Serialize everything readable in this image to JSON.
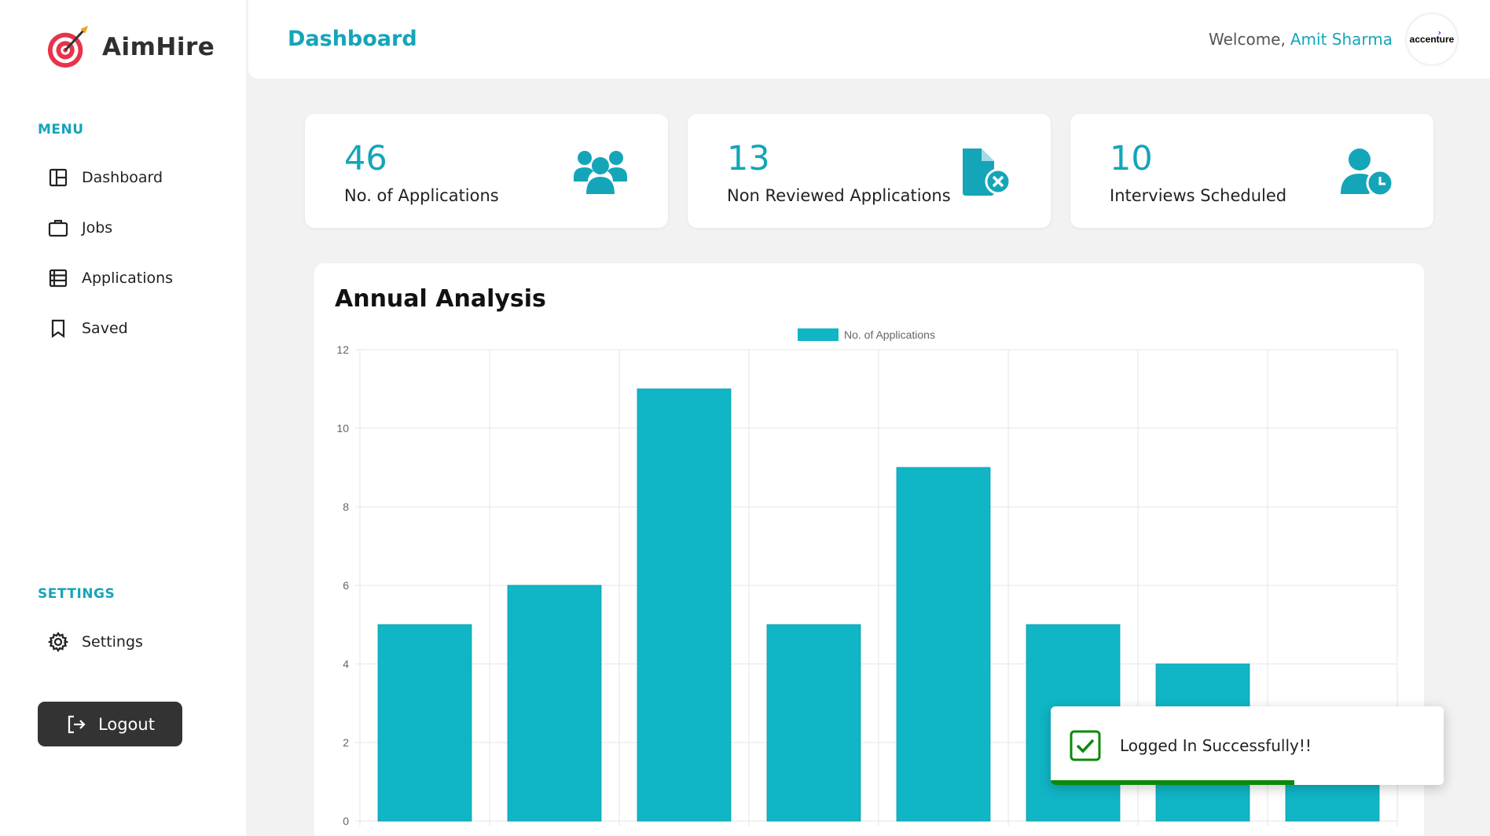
{
  "app": {
    "name": "AimHire"
  },
  "sidebar": {
    "menu_title": "MENU",
    "items": [
      {
        "label": "Dashboard",
        "icon": "layout-icon"
      },
      {
        "label": "Jobs",
        "icon": "briefcase-icon"
      },
      {
        "label": "Applications",
        "icon": "list-icon"
      },
      {
        "label": "Saved",
        "icon": "bookmark-icon"
      }
    ],
    "settings_title": "SETTINGS",
    "settings_item": {
      "label": "Settings",
      "icon": "gear-icon"
    },
    "logout_label": "Logout"
  },
  "header": {
    "title": "Dashboard",
    "welcome": "Welcome,",
    "user_name": "Amit Sharma",
    "company_logo_text": "accenture"
  },
  "stats": [
    {
      "value": "46",
      "label": "No. of Applications",
      "icon": "users-group-icon"
    },
    {
      "value": "13",
      "label": "Non Reviewed Applications",
      "icon": "file-x-icon"
    },
    {
      "value": "10",
      "label": "Interviews Scheduled",
      "icon": "user-clock-icon"
    }
  ],
  "chart_panel": {
    "title": "Annual Analysis"
  },
  "chart_data": {
    "type": "bar",
    "series": [
      {
        "name": "No. of Applications",
        "values": [
          5,
          6,
          11,
          5,
          9,
          5,
          4,
          2
        ]
      }
    ],
    "yticks": [
      "0",
      "2",
      "4",
      "6",
      "8",
      "10",
      "12"
    ],
    "ylim": [
      0,
      12
    ],
    "grid": true,
    "legend": "top-center",
    "color": "#10b5c6"
  },
  "toast": {
    "message": "Logged In Successfully!!",
    "progress": 0.62
  },
  "colors": {
    "accent": "#14a5b8",
    "bar": "#10b5c6",
    "success": "#0a8a0a",
    "dark_button": "#333333"
  }
}
